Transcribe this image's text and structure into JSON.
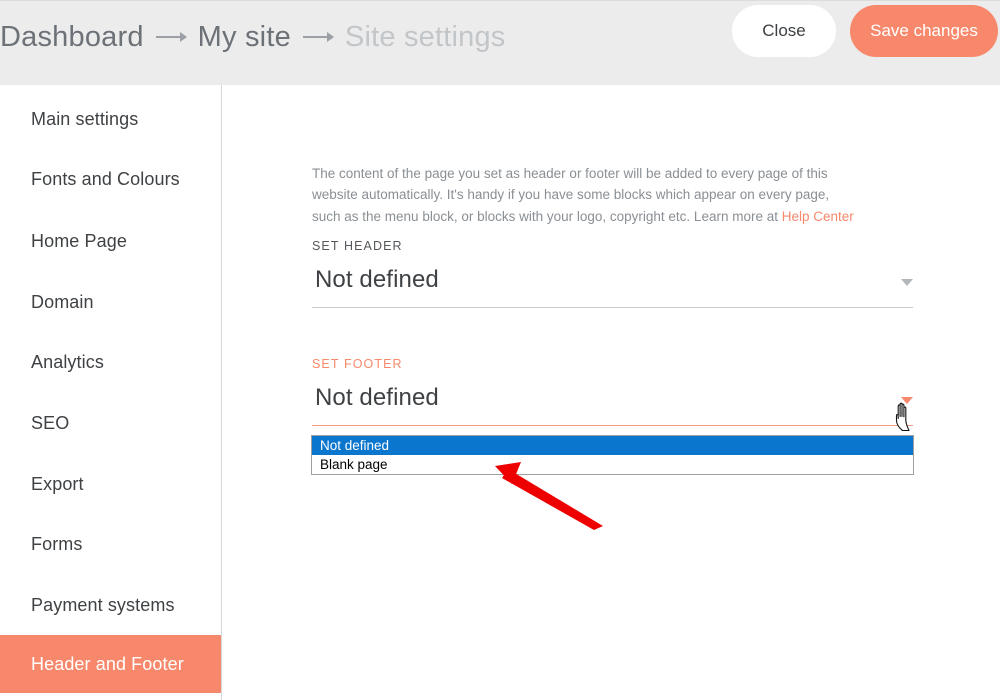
{
  "topbar": {
    "breadcrumb": [
      {
        "label": "Dashboard",
        "state": "link"
      },
      {
        "label": "My site",
        "state": "link"
      },
      {
        "label": "Site settings",
        "state": "current"
      }
    ],
    "separator_icon": "arrow-right-icon",
    "buttons": {
      "close": "Close",
      "save": "Save changes"
    }
  },
  "sidebar": {
    "items": [
      {
        "label": "Main settings",
        "active": false
      },
      {
        "label": "Fonts and Colours",
        "active": false
      },
      {
        "label": "Home Page",
        "active": false
      },
      {
        "label": "Domain",
        "active": false
      },
      {
        "label": "Analytics",
        "active": false
      },
      {
        "label": "SEO",
        "active": false
      },
      {
        "label": "Export",
        "active": false
      },
      {
        "label": "Forms",
        "active": false
      },
      {
        "label": "Payment systems",
        "active": false
      },
      {
        "label": "Header and Footer",
        "active": true
      }
    ]
  },
  "main": {
    "intro_text_1": "The content of the page you set as header or footer will be added to every page of this website automatically. It's handy if you have some blocks which appear on every page, such as the menu block, or blocks with your logo, copyright etc. Learn more at ",
    "intro_link": "Help Center",
    "header_field": {
      "label": "SET HEADER",
      "value": "Not defined",
      "caret_icon": "chevron-down-icon"
    },
    "footer_field": {
      "label": "SET FOOTER",
      "value": "Not defined",
      "caret_icon": "chevron-down-icon"
    },
    "footer_dropdown": {
      "open": true,
      "options": [
        {
          "label": "Not defined",
          "selected": true
        },
        {
          "label": "Blank page",
          "selected": false
        }
      ]
    }
  },
  "overlays": {
    "cursor_icon": "pointing-hand-cursor",
    "annotation_icon": "red-arrow-annotation"
  },
  "colors": {
    "accent": "#f8886b",
    "topbar_bg": "#ececec",
    "dropdown_highlight": "#0b76ce",
    "text_primary": "#3f4245",
    "text_muted": "#8a8f94",
    "annotation_red": "#ee0000"
  }
}
